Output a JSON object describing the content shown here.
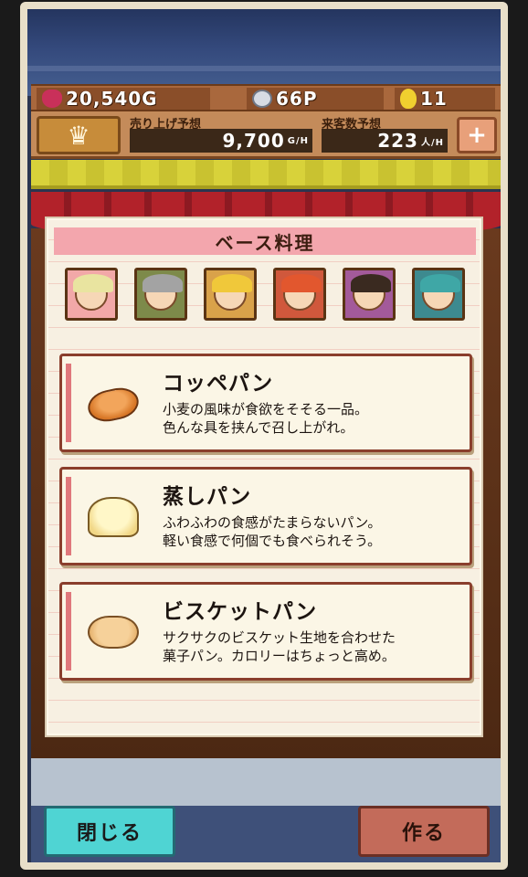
{
  "status": {
    "gold": "20,540G",
    "points": "66P",
    "eggs": "11"
  },
  "forecast": {
    "sales_label": "売り上げ予想",
    "sales_value": "9,700",
    "sales_unit": "G/H",
    "customers_label": "来客数予想",
    "customers_value": "223",
    "customers_unit": "人/H"
  },
  "panel": {
    "title": "ベース料理",
    "characters": [
      {
        "name": "char-1",
        "bg": "#f2a8a8",
        "hair": "#e9e4a0"
      },
      {
        "name": "char-2",
        "bg": "#7d8a4a",
        "hair": "#a3a3a3"
      },
      {
        "name": "char-3",
        "bg": "#d9a24a",
        "hair": "#f0c83a"
      },
      {
        "name": "char-4",
        "bg": "#d0583c",
        "hair": "#e2572e"
      },
      {
        "name": "char-5",
        "bg": "#a35a9a",
        "hair": "#3a2a20"
      },
      {
        "name": "char-6",
        "bg": "#3d8a8f",
        "hair": "#3fa7a6"
      }
    ],
    "items": [
      {
        "name": "コッペパン",
        "desc": "小麦の風味が食欲をそそる一品。\n色んな具を挟んで召し上がれ。",
        "icon": "koppe-bread-icon"
      },
      {
        "name": "蒸しパン",
        "desc": "ふわふわの食感がたまらないパン。\n軽い食感で何個でも食べられそう。",
        "icon": "steamed-bun-icon"
      },
      {
        "name": "ビスケットパン",
        "desc": "サクサクのビスケット生地を合わせた\n菓子パン。カロリーはちょっと高め。",
        "icon": "biscuit-bread-icon"
      }
    ]
  },
  "buttons": {
    "close": "閉じる",
    "make": "作る"
  }
}
